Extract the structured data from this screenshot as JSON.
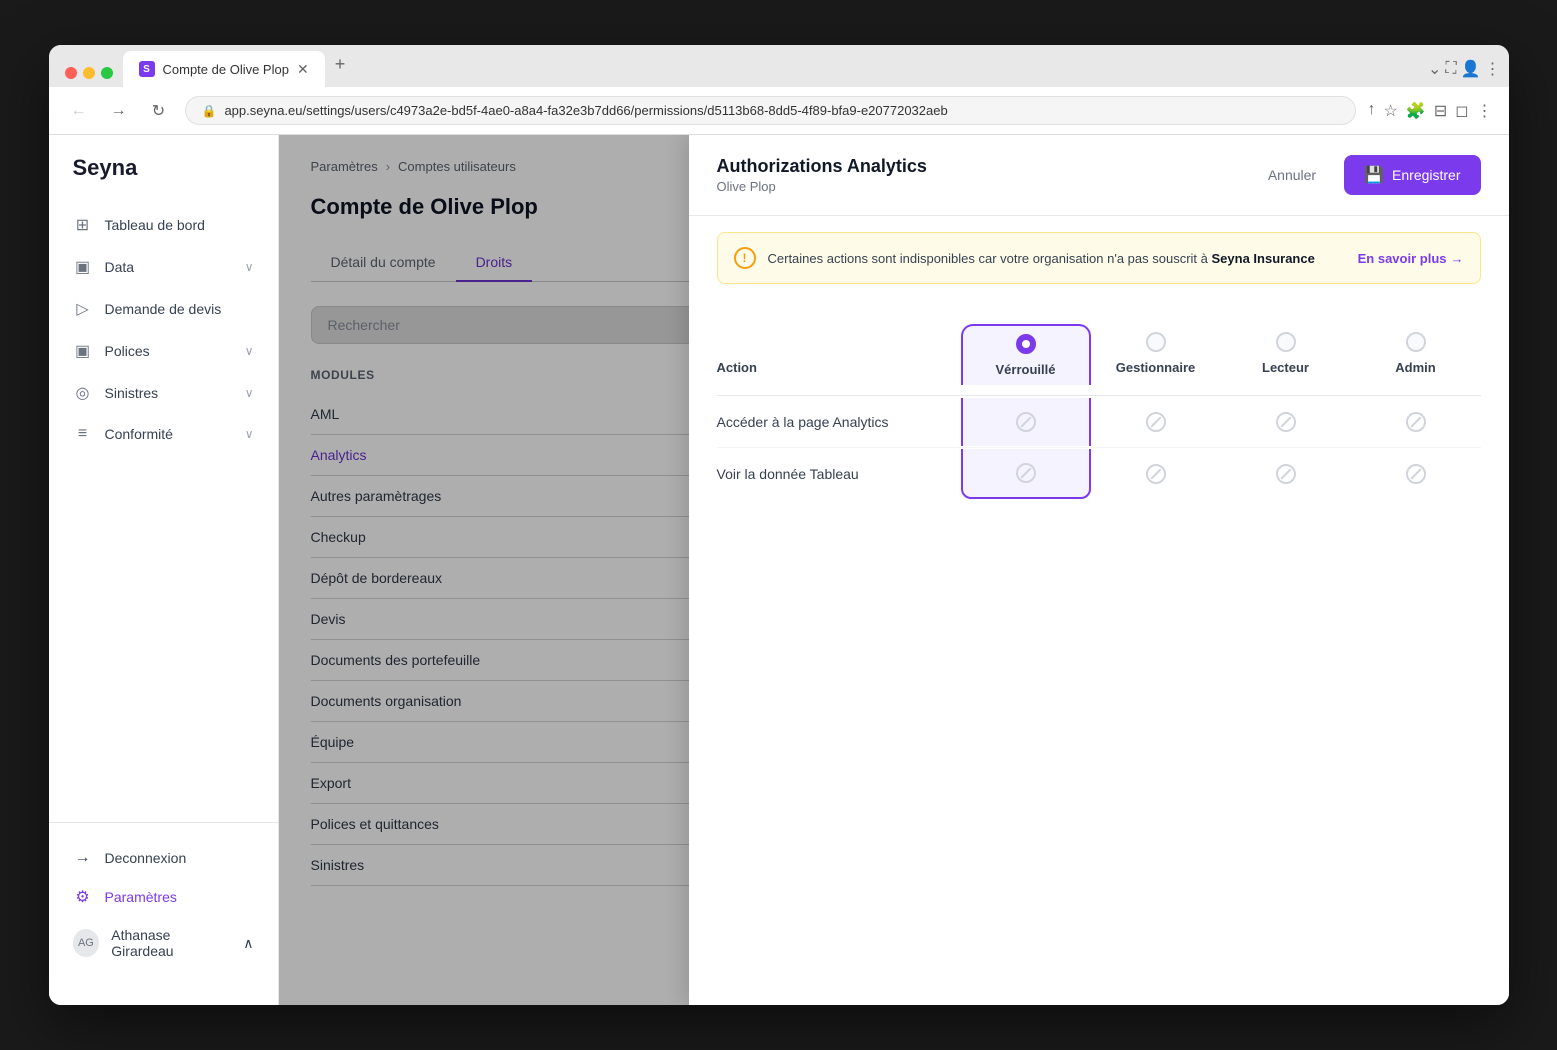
{
  "browser": {
    "tab_label": "Compte de Olive Plop",
    "url": "app.seyna.eu/settings/users/c4973a2e-bd5f-4ae0-a8a4-fa32e3b7dd66/permissions/d5113b68-8dd5-4f89-bfa9-e20772032aeb"
  },
  "sidebar": {
    "logo": "Seyna",
    "nav_items": [
      {
        "id": "tableau-de-bord",
        "label": "Tableau de bord",
        "icon": "⊞",
        "has_arrow": false
      },
      {
        "id": "data",
        "label": "Data",
        "icon": "▣",
        "has_arrow": true
      },
      {
        "id": "demande-de-devis",
        "label": "Demande de devis",
        "icon": "▷",
        "has_arrow": false
      },
      {
        "id": "polices",
        "label": "Polices",
        "icon": "▣",
        "has_arrow": true
      },
      {
        "id": "sinistres",
        "label": "Sinistres",
        "icon": "◎",
        "has_arrow": true
      },
      {
        "id": "conformite",
        "label": "Conformité",
        "icon": "≡",
        "has_arrow": true
      }
    ],
    "bottom_items": [
      {
        "id": "deconnexion",
        "label": "Deconnexion",
        "icon": "→"
      },
      {
        "id": "parametres",
        "label": "Paramètres",
        "icon": "⚙",
        "active": true
      }
    ],
    "user": "Athanase Girardeau"
  },
  "page": {
    "breadcrumb": [
      "Paramètres",
      "Comptes utilisateurs"
    ],
    "title": "Compte de Olive Plop",
    "tabs": [
      {
        "id": "detail",
        "label": "Détail du compte",
        "active": false
      },
      {
        "id": "droits",
        "label": "Droits",
        "active": true
      }
    ],
    "search_placeholder": "Rechercher",
    "modules_title": "Modules",
    "modules": [
      {
        "id": "aml",
        "label": "AML",
        "active": false
      },
      {
        "id": "analytics",
        "label": "Analytics",
        "active": true
      },
      {
        "id": "autres-parametrages",
        "label": "Autres paramètrages",
        "active": false
      },
      {
        "id": "checkup",
        "label": "Checkup",
        "active": false
      },
      {
        "id": "depot-bordereauxs",
        "label": "Dépôt de bordereaux",
        "active": false
      },
      {
        "id": "devis",
        "label": "Devis",
        "active": false
      },
      {
        "id": "documents-portefeuille",
        "label": "Documents des portefeuille",
        "active": false
      },
      {
        "id": "documents-organisation",
        "label": "Documents organisation",
        "active": false
      },
      {
        "id": "equipe",
        "label": "Équipe",
        "active": false
      },
      {
        "id": "export",
        "label": "Export",
        "active": false
      },
      {
        "id": "polices-quittances",
        "label": "Polices et quittances",
        "active": false
      },
      {
        "id": "sinistres",
        "label": "Sinistres",
        "active": false
      }
    ]
  },
  "modal": {
    "title": "Authorizations Analytics",
    "subtitle": "Olive Plop",
    "cancel_label": "Annuler",
    "save_label": "Enregistrer",
    "alert": {
      "text": "Certaines actions sont indisponibles car votre organisation n'a pas souscrit à ",
      "brand": "Seyna Insurance",
      "link_label": "En savoir plus",
      "link_arrow": "→"
    },
    "table": {
      "action_col_header": "Action",
      "columns": [
        {
          "id": "verrouille",
          "label": "Vérrouillé",
          "selected": true
        },
        {
          "id": "gestionnaire",
          "label": "Gestionnaire",
          "selected": false
        },
        {
          "id": "lecteur",
          "label": "Lecteur",
          "selected": false
        },
        {
          "id": "admin",
          "label": "Admin",
          "selected": false
        }
      ],
      "rows": [
        {
          "action": "Accéder à la page Analytics",
          "verrouille": "disabled",
          "gestionnaire": "disabled",
          "lecteur": "disabled",
          "admin": "disabled"
        },
        {
          "action": "Voir la donnée Tableau",
          "verrouille": "disabled",
          "gestionnaire": "disabled",
          "lecteur": "disabled",
          "admin": "disabled"
        }
      ]
    }
  }
}
